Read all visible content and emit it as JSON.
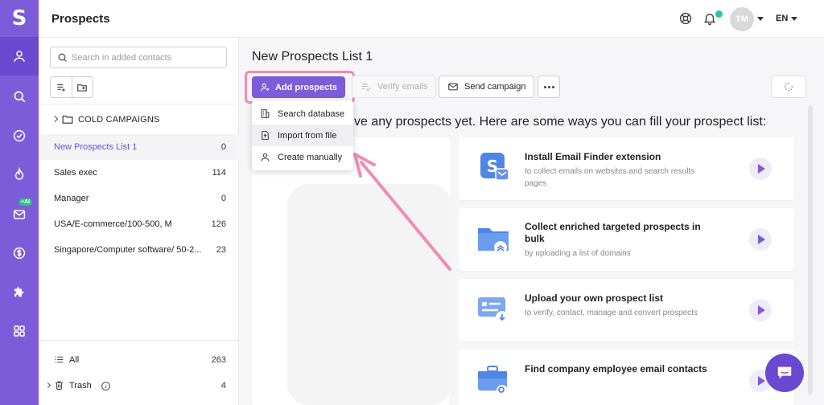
{
  "app": {
    "logo": "S",
    "title": "Prospects"
  },
  "header": {
    "avatar_initials": "TM",
    "language": "EN",
    "notification_color": "#23c8a8"
  },
  "colors": {
    "brand": "#7c5cd9",
    "brand_dark": "#6a48cf",
    "highlight": "#f08ab2",
    "ai_badge": "#2dc27a"
  },
  "rail": {
    "ai_badge": "+AI",
    "items": [
      "user-icon",
      "search-icon",
      "check-circle-icon",
      "fire-icon",
      "mail-icon",
      "dollar-icon",
      "puzzle-icon",
      "grid-icon"
    ]
  },
  "sidebar": {
    "search_placeholder": "Search in added contacts",
    "folder": "COLD CAMPAIGNS",
    "lists": [
      {
        "name": "New Prospects List 1",
        "count": "0"
      },
      {
        "name": "Sales exec",
        "count": "114"
      },
      {
        "name": "Manager",
        "count": "0"
      },
      {
        "name": "USA/E-commerce/100-500, M",
        "count": "126"
      },
      {
        "name": "Singapore/Computer software/ 50-2...",
        "count": "23"
      }
    ],
    "all": {
      "label": "All",
      "count": "263"
    },
    "trash": {
      "label": "Trash",
      "count": "4"
    }
  },
  "main": {
    "list_title": "New Prospects List 1",
    "add_prospects": "Add prospects",
    "verify_emails": "Verify emails",
    "send_campaign": "Send campaign",
    "empty_message": "ve any prospects yet. Here are some ways you can fill your prospect list:",
    "dropdown": [
      "Search database",
      "Import from file",
      "Create manually"
    ],
    "cards": [
      {
        "title": "Install Email Finder extension",
        "subtitle": "to collect emails on websites and search results pages"
      },
      {
        "title": "Collect enriched targeted prospects in bulk",
        "subtitle": "by uploading a list of domains"
      },
      {
        "title": "Upload your own prospect list",
        "subtitle": "to verify, contact, manage and convert prospects"
      },
      {
        "title": "Find company employee email contacts",
        "subtitle": ""
      }
    ]
  }
}
